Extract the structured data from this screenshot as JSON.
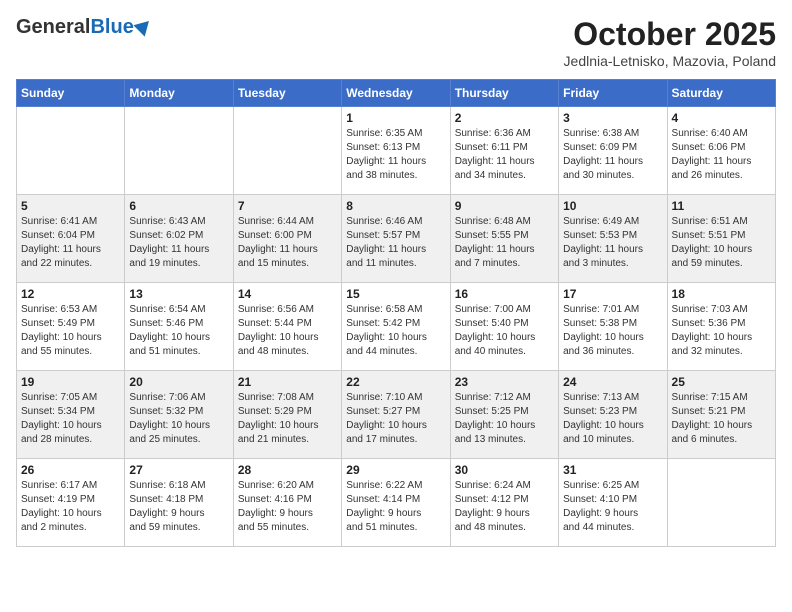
{
  "header": {
    "logo_general": "General",
    "logo_blue": "Blue",
    "month_title": "October 2025",
    "location": "Jedlnia-Letnisko, Mazovia, Poland"
  },
  "weekdays": [
    "Sunday",
    "Monday",
    "Tuesday",
    "Wednesday",
    "Thursday",
    "Friday",
    "Saturday"
  ],
  "weeks": [
    [
      {
        "day": "",
        "info": ""
      },
      {
        "day": "",
        "info": ""
      },
      {
        "day": "",
        "info": ""
      },
      {
        "day": "1",
        "info": "Sunrise: 6:35 AM\nSunset: 6:13 PM\nDaylight: 11 hours\nand 38 minutes."
      },
      {
        "day": "2",
        "info": "Sunrise: 6:36 AM\nSunset: 6:11 PM\nDaylight: 11 hours\nand 34 minutes."
      },
      {
        "day": "3",
        "info": "Sunrise: 6:38 AM\nSunset: 6:09 PM\nDaylight: 11 hours\nand 30 minutes."
      },
      {
        "day": "4",
        "info": "Sunrise: 6:40 AM\nSunset: 6:06 PM\nDaylight: 11 hours\nand 26 minutes."
      }
    ],
    [
      {
        "day": "5",
        "info": "Sunrise: 6:41 AM\nSunset: 6:04 PM\nDaylight: 11 hours\nand 22 minutes."
      },
      {
        "day": "6",
        "info": "Sunrise: 6:43 AM\nSunset: 6:02 PM\nDaylight: 11 hours\nand 19 minutes."
      },
      {
        "day": "7",
        "info": "Sunrise: 6:44 AM\nSunset: 6:00 PM\nDaylight: 11 hours\nand 15 minutes."
      },
      {
        "day": "8",
        "info": "Sunrise: 6:46 AM\nSunset: 5:57 PM\nDaylight: 11 hours\nand 11 minutes."
      },
      {
        "day": "9",
        "info": "Sunrise: 6:48 AM\nSunset: 5:55 PM\nDaylight: 11 hours\nand 7 minutes."
      },
      {
        "day": "10",
        "info": "Sunrise: 6:49 AM\nSunset: 5:53 PM\nDaylight: 11 hours\nand 3 minutes."
      },
      {
        "day": "11",
        "info": "Sunrise: 6:51 AM\nSunset: 5:51 PM\nDaylight: 10 hours\nand 59 minutes."
      }
    ],
    [
      {
        "day": "12",
        "info": "Sunrise: 6:53 AM\nSunset: 5:49 PM\nDaylight: 10 hours\nand 55 minutes."
      },
      {
        "day": "13",
        "info": "Sunrise: 6:54 AM\nSunset: 5:46 PM\nDaylight: 10 hours\nand 51 minutes."
      },
      {
        "day": "14",
        "info": "Sunrise: 6:56 AM\nSunset: 5:44 PM\nDaylight: 10 hours\nand 48 minutes."
      },
      {
        "day": "15",
        "info": "Sunrise: 6:58 AM\nSunset: 5:42 PM\nDaylight: 10 hours\nand 44 minutes."
      },
      {
        "day": "16",
        "info": "Sunrise: 7:00 AM\nSunset: 5:40 PM\nDaylight: 10 hours\nand 40 minutes."
      },
      {
        "day": "17",
        "info": "Sunrise: 7:01 AM\nSunset: 5:38 PM\nDaylight: 10 hours\nand 36 minutes."
      },
      {
        "day": "18",
        "info": "Sunrise: 7:03 AM\nSunset: 5:36 PM\nDaylight: 10 hours\nand 32 minutes."
      }
    ],
    [
      {
        "day": "19",
        "info": "Sunrise: 7:05 AM\nSunset: 5:34 PM\nDaylight: 10 hours\nand 28 minutes."
      },
      {
        "day": "20",
        "info": "Sunrise: 7:06 AM\nSunset: 5:32 PM\nDaylight: 10 hours\nand 25 minutes."
      },
      {
        "day": "21",
        "info": "Sunrise: 7:08 AM\nSunset: 5:29 PM\nDaylight: 10 hours\nand 21 minutes."
      },
      {
        "day": "22",
        "info": "Sunrise: 7:10 AM\nSunset: 5:27 PM\nDaylight: 10 hours\nand 17 minutes."
      },
      {
        "day": "23",
        "info": "Sunrise: 7:12 AM\nSunset: 5:25 PM\nDaylight: 10 hours\nand 13 minutes."
      },
      {
        "day": "24",
        "info": "Sunrise: 7:13 AM\nSunset: 5:23 PM\nDaylight: 10 hours\nand 10 minutes."
      },
      {
        "day": "25",
        "info": "Sunrise: 7:15 AM\nSunset: 5:21 PM\nDaylight: 10 hours\nand 6 minutes."
      }
    ],
    [
      {
        "day": "26",
        "info": "Sunrise: 6:17 AM\nSunset: 4:19 PM\nDaylight: 10 hours\nand 2 minutes."
      },
      {
        "day": "27",
        "info": "Sunrise: 6:18 AM\nSunset: 4:18 PM\nDaylight: 9 hours\nand 59 minutes."
      },
      {
        "day": "28",
        "info": "Sunrise: 6:20 AM\nSunset: 4:16 PM\nDaylight: 9 hours\nand 55 minutes."
      },
      {
        "day": "29",
        "info": "Sunrise: 6:22 AM\nSunset: 4:14 PM\nDaylight: 9 hours\nand 51 minutes."
      },
      {
        "day": "30",
        "info": "Sunrise: 6:24 AM\nSunset: 4:12 PM\nDaylight: 9 hours\nand 48 minutes."
      },
      {
        "day": "31",
        "info": "Sunrise: 6:25 AM\nSunset: 4:10 PM\nDaylight: 9 hours\nand 44 minutes."
      },
      {
        "day": "",
        "info": ""
      }
    ]
  ]
}
